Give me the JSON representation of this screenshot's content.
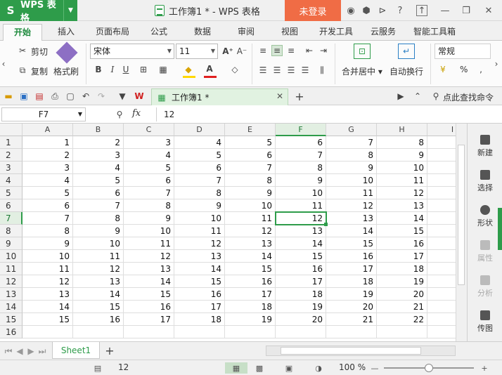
{
  "app": {
    "logo": "S",
    "name": "WPS 表格",
    "dropdown_icon": "chevron-down-icon"
  },
  "window": {
    "title": "工作簿1 * - WPS 表格",
    "login_label": "未登录"
  },
  "tabs": [
    {
      "label": "开始",
      "active": true
    },
    {
      "label": "插入"
    },
    {
      "label": "页面布局"
    },
    {
      "label": "公式"
    },
    {
      "label": "数据"
    },
    {
      "label": "审阅"
    },
    {
      "label": "视图"
    },
    {
      "label": "开发工具"
    },
    {
      "label": "云服务"
    },
    {
      "label": "智能工具箱"
    }
  ],
  "ribbon": {
    "cut": "剪切",
    "copy": "复制",
    "format_painter": "格式刷",
    "font_name": "宋体",
    "font_size": "11",
    "merge_center": "合并居中",
    "wrap_text": "自动换行",
    "number_format": "常规",
    "percent": "%"
  },
  "qat": {
    "doc_tab": "工作簿1 *",
    "search": "点此查找命令"
  },
  "formula_bar": {
    "name_box": "F7",
    "fx": "fx",
    "value": "12"
  },
  "grid": {
    "columns": [
      "A",
      "B",
      "C",
      "D",
      "E",
      "F",
      "G",
      "H",
      "I"
    ],
    "selected_column": "F",
    "selected_row": 7,
    "rows": [
      [
        1,
        2,
        3,
        4,
        5,
        6,
        7,
        8
      ],
      [
        2,
        3,
        4,
        5,
        6,
        7,
        8,
        9
      ],
      [
        3,
        4,
        5,
        6,
        7,
        8,
        9,
        10
      ],
      [
        4,
        5,
        6,
        7,
        8,
        9,
        10,
        11
      ],
      [
        5,
        6,
        7,
        8,
        9,
        10,
        11,
        12
      ],
      [
        6,
        7,
        8,
        9,
        10,
        11,
        12,
        13
      ],
      [
        7,
        8,
        9,
        10,
        11,
        12,
        13,
        14
      ],
      [
        8,
        9,
        10,
        11,
        12,
        13,
        14,
        15
      ],
      [
        9,
        10,
        11,
        12,
        13,
        14,
        15,
        16
      ],
      [
        10,
        11,
        12,
        13,
        14,
        15,
        16,
        17
      ],
      [
        11,
        12,
        13,
        14,
        15,
        16,
        17,
        18
      ],
      [
        12,
        13,
        14,
        15,
        16,
        17,
        18,
        19
      ],
      [
        13,
        14,
        15,
        16,
        17,
        18,
        19,
        20
      ],
      [
        14,
        15,
        16,
        17,
        18,
        19,
        20,
        21
      ],
      [
        15,
        16,
        17,
        18,
        19,
        20,
        21,
        22
      ],
      []
    ]
  },
  "side_panel": [
    {
      "label": "新建",
      "enabled": true
    },
    {
      "label": "选择",
      "enabled": true
    },
    {
      "label": "形状",
      "enabled": true
    },
    {
      "label": "属性",
      "enabled": false
    },
    {
      "label": "分析",
      "enabled": false
    },
    {
      "label": "传图",
      "enabled": true
    }
  ],
  "sheet_tabs": [
    {
      "label": "Sheet1",
      "active": true
    }
  ],
  "status": {
    "sum": "12",
    "zoom": "100 %"
  }
}
